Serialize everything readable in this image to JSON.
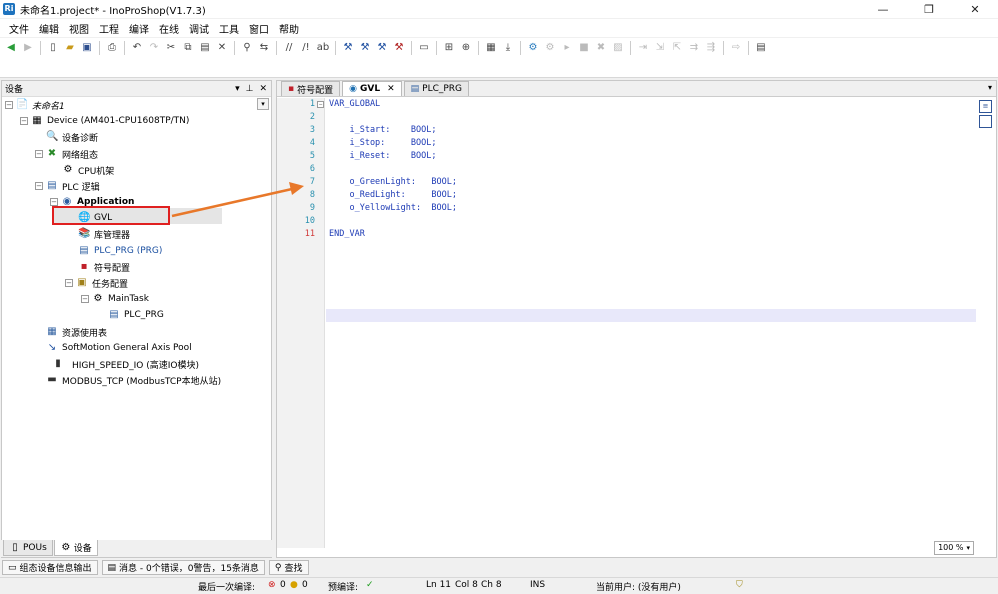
{
  "window": {
    "title": "未命名1.project* - InoProShop(V1.7.3)",
    "app_icon": "Ri",
    "controls": [
      "—",
      "❐",
      "✕"
    ]
  },
  "menu": [
    "文件",
    "编辑",
    "视图",
    "工程",
    "编译",
    "在线",
    "调试",
    "工具",
    "窗口",
    "帮助"
  ],
  "device_panel": {
    "title": "设备",
    "controls": [
      "▾",
      "⊥",
      "✕"
    ],
    "tree": [
      {
        "label": "未命名1",
        "icon": "project-icon",
        "glyph": "📄"
      },
      {
        "label": "Device (AM401-CPU1608TP/TN)",
        "icon": "device-icon",
        "glyph": "▦"
      },
      {
        "label": "设备诊断",
        "icon": "diagnostics-icon",
        "glyph": "🔍"
      },
      {
        "label": "网络组态",
        "icon": "network-icon",
        "glyph": "✖"
      },
      {
        "label": "CPU机架",
        "icon": "rack-icon",
        "glyph": "⚙"
      },
      {
        "label": "PLC 逻辑",
        "icon": "plc-logic-icon",
        "glyph": "▤"
      },
      {
        "label": "Application",
        "icon": "application-icon",
        "glyph": "◉"
      },
      {
        "label": "GVL",
        "icon": "gvl-globe-icon",
        "glyph": "🌐"
      },
      {
        "label": "库管理器",
        "icon": "library-icon",
        "glyph": "📚"
      },
      {
        "label": "PLC_PRG (PRG)",
        "icon": "pou-icon",
        "glyph": "▤"
      },
      {
        "label": "符号配置",
        "icon": "symbol-config-icon",
        "glyph": "▪"
      },
      {
        "label": "任务配置",
        "icon": "task-config-icon",
        "glyph": "▣"
      },
      {
        "label": "MainTask",
        "icon": "maintask-icon",
        "glyph": "⚙"
      },
      {
        "label": "PLC_PRG",
        "icon": "program-call-icon",
        "glyph": "▤"
      },
      {
        "label": "资源使用表",
        "icon": "resource-table-icon",
        "glyph": "▦"
      },
      {
        "label": "SoftMotion General Axis Pool",
        "icon": "axis-pool-icon",
        "glyph": "↘"
      },
      {
        "label": "HIGH_SPEED_IO (高速IO模块)",
        "icon": "io-module-icon",
        "glyph": "▮"
      },
      {
        "label": "MODBUS_TCP (ModbusTCP本地从站)",
        "icon": "modbus-icon",
        "glyph": "▬"
      }
    ],
    "bottom_tabs": [
      "POUs",
      "设备"
    ]
  },
  "editor": {
    "tabs": [
      {
        "label": "符号配置",
        "active": false,
        "closable": false
      },
      {
        "label": "GVL",
        "active": true,
        "closable": true
      },
      {
        "label": "PLC_PRG",
        "active": false,
        "closable": false
      }
    ],
    "lines": [
      {
        "n": "1",
        "text": "VAR_GLOBAL"
      },
      {
        "n": "2",
        "text": ""
      },
      {
        "n": "3",
        "text": "    i_Start:    BOOL;"
      },
      {
        "n": "4",
        "text": "    i_Stop:     BOOL;"
      },
      {
        "n": "5",
        "text": "    i_Reset:    BOOL;"
      },
      {
        "n": "6",
        "text": ""
      },
      {
        "n": "7",
        "text": "    o_GreenLight:   BOOL;"
      },
      {
        "n": "8",
        "text": "    o_RedLight:     BOOL;"
      },
      {
        "n": "9",
        "text": "    o_YellowLight:  BOOL;"
      },
      {
        "n": "10",
        "text": ""
      },
      {
        "n": "11",
        "text": "END_VAR"
      }
    ],
    "zoom": "100 %"
  },
  "output_tabs": [
    {
      "label": "组态设备信息输出"
    },
    {
      "label": "消息 - 0个错误，0警告，15条消息"
    },
    {
      "label": "查找"
    }
  ],
  "status": {
    "last_build_label": "最后一次编译:",
    "errors": "0",
    "warnings": "0",
    "precompile_label": "预编译:",
    "line": "Ln 11",
    "col": "Col 8",
    "ch": "Ch 8",
    "mode": "INS",
    "user": "当前用户: (没有用户)"
  },
  "colors": {
    "annotation_box": "#e02020",
    "annotation_arrow": "#e8782a",
    "keyword": "#1e3bb5"
  }
}
